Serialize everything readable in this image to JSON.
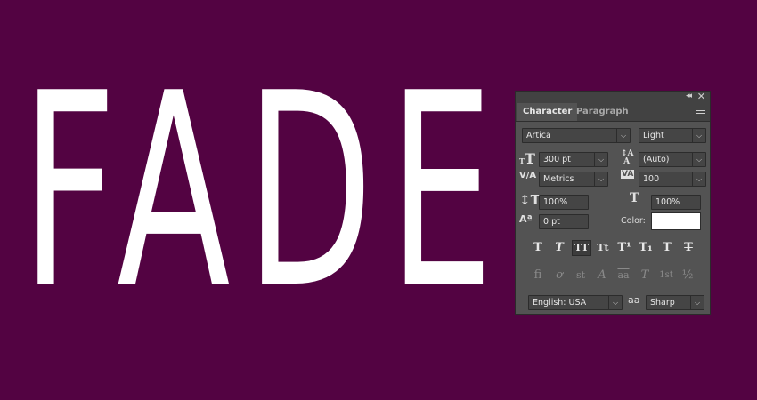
{
  "canvas": {
    "text": "FADE"
  },
  "panel": {
    "tabs": [
      "Character",
      "Paragraph"
    ],
    "font_family": "Artica",
    "font_style": "Light",
    "font_size": "300 pt",
    "leading": "(Auto)",
    "kerning": "Metrics",
    "tracking": "100",
    "vertical_scale": "100%",
    "horizontal_scale": "100%",
    "baseline_shift": "0 pt",
    "color_label": "Color:",
    "color_value": "#ffffff",
    "language": "English: USA",
    "antialias": "Sharp",
    "antialias_icon_text": "aa",
    "format_buttons": [
      "T",
      "T",
      "TT",
      "Tt",
      "T¹",
      "T₁",
      "T",
      "T"
    ],
    "opentype_buttons": [
      "fi",
      "ơ",
      "st",
      "A",
      "aa",
      "T",
      "1st",
      "½"
    ]
  },
  "colors": {
    "background": "#530342",
    "panel": "#535353",
    "text": "#ffffff"
  }
}
